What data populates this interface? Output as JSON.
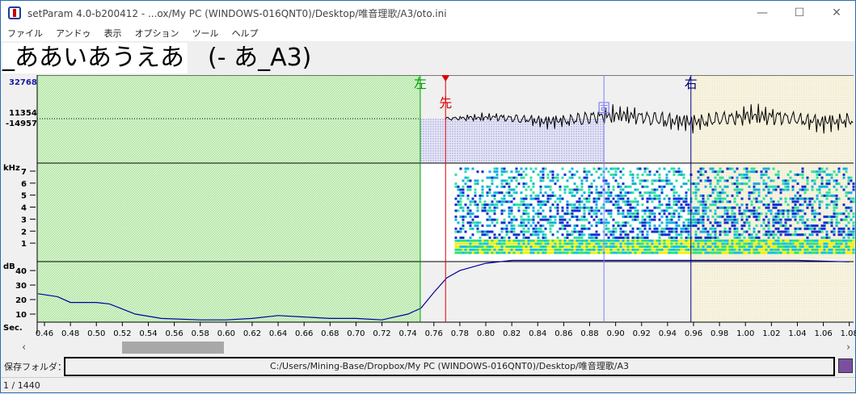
{
  "window": {
    "title": "setParam 4.0-b200412 -  ...ox/My PC (WINDOWS-016QNT0)/Desktop/唯音理歌/A3/oto.ini",
    "minimize": "—",
    "maximize": "☐",
    "close": "✕"
  },
  "menu": [
    "ファイル",
    "アンドゥ",
    "表示",
    "オプション",
    "ツール",
    "ヘルプ"
  ],
  "entry": {
    "filename": "_ああいあうえあ",
    "alias": "(- あ_A3)"
  },
  "chart_data": {
    "type": "line",
    "wave_labels": {
      "max": "32768",
      "upper": "11354",
      "lower": "-14957"
    },
    "spec_label": "kHz",
    "spec_ticks": [
      "7",
      "6",
      "5",
      "4",
      "3",
      "2",
      "1"
    ],
    "db_label": "dB",
    "db_ticks": [
      "40",
      "30",
      "20",
      "10"
    ],
    "x_label": "Sec.",
    "x_ticks": [
      "0.46",
      "0.48",
      "0.50",
      "0.52",
      "0.54",
      "0.56",
      "0.58",
      "0.60",
      "0.62",
      "0.64",
      "0.66",
      "0.68",
      "0.70",
      "0.72",
      "0.74",
      "0.76",
      "0.78",
      "0.80",
      "0.82",
      "0.84",
      "0.86",
      "0.88",
      "0.90",
      "0.92",
      "0.94",
      "0.96",
      "0.98",
      "1.00",
      "1.02",
      "1.04",
      "1.06",
      "1.08"
    ],
    "xlim": [
      0.4544,
      1.0833
    ],
    "markers": {
      "offset_sec": 0.7495,
      "preutterance_sec": 0.769,
      "fixed_sec": 0.891,
      "cutoff_sec": 0.958
    },
    "marker_labels": {
      "offset": "左",
      "preutterance": "先",
      "fixed": "固",
      "cutoff": "右"
    },
    "power_db": {
      "t": [
        0.455,
        0.47,
        0.48,
        0.5,
        0.51,
        0.53,
        0.55,
        0.58,
        0.6,
        0.62,
        0.64,
        0.66,
        0.68,
        0.7,
        0.72,
        0.74,
        0.75,
        0.76,
        0.77,
        0.78,
        0.8,
        0.82,
        0.86,
        0.9,
        0.96,
        1.0,
        1.04,
        1.08
      ],
      "db": [
        24,
        22,
        18,
        18,
        17,
        10,
        7,
        6,
        6,
        7,
        9,
        8,
        7,
        7,
        6,
        10,
        14,
        25,
        35,
        40,
        45,
        47,
        47,
        47,
        47,
        47,
        47,
        46
      ]
    },
    "colors": {
      "offset": "#00a000",
      "preutterance": "#e00000",
      "fixed": "#8080ff",
      "cutoff": "#000080"
    }
  },
  "scrollbar": {
    "left": "‹",
    "right": "›"
  },
  "folder": {
    "label": "保存フォルダ：",
    "path": "C:/Users/Mining-Base/Dropbox/My PC (WINDOWS-016QNT0)/Desktop/唯音理歌/A3"
  },
  "status": "1 / 1440"
}
